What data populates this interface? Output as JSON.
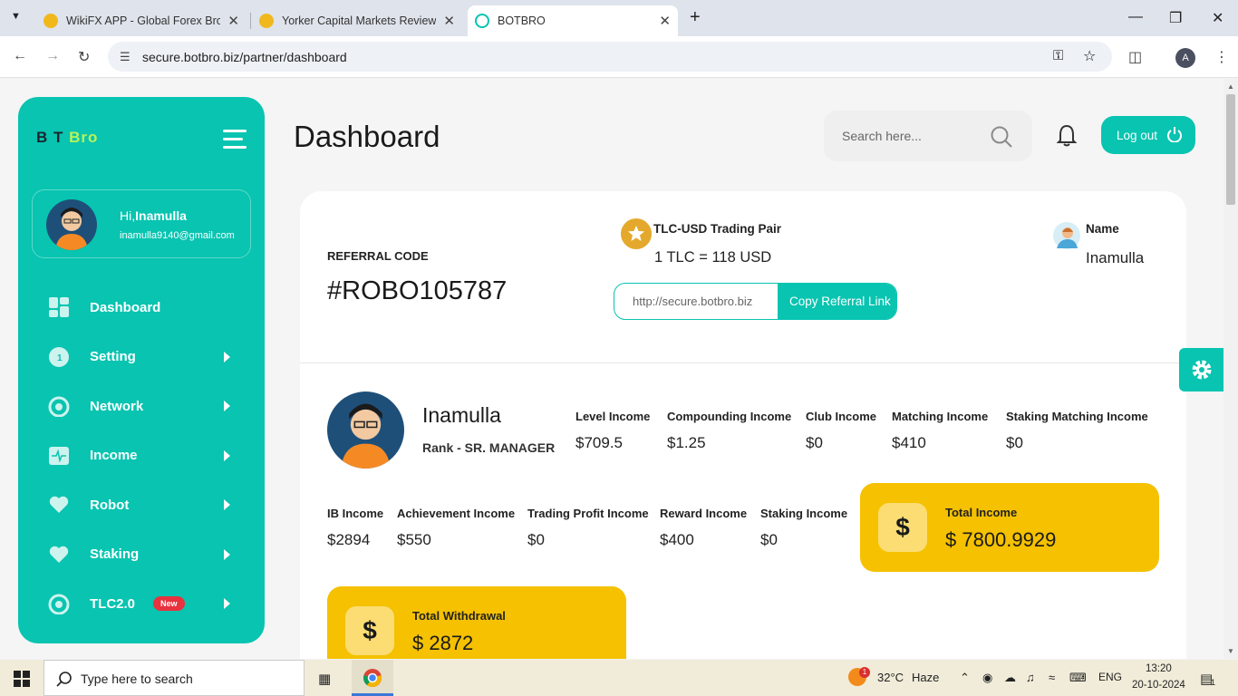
{
  "browser": {
    "tabs": [
      {
        "title": "WikiFX APP - Global Forex Brok",
        "active": false
      },
      {
        "title": "Yorker Capital Markets Review, I",
        "active": false
      },
      {
        "title": "BOTBRO",
        "active": true
      }
    ],
    "url": "secure.botbro.biz/partner/dashboard",
    "profile_initial": "A"
  },
  "sidebar": {
    "logo_bot": "B  T",
    "logo_bro": "Bro",
    "greeting": "Hi,",
    "user": "Inamulla",
    "email": "inamulla9140@gmail.com",
    "items": [
      {
        "label": "Dashboard",
        "icon": "dashboard-icon",
        "arrow": false
      },
      {
        "label": "Setting",
        "icon": "setting-icon",
        "arrow": true
      },
      {
        "label": "Network",
        "icon": "network-icon",
        "arrow": true
      },
      {
        "label": "Income",
        "icon": "income-icon",
        "arrow": true
      },
      {
        "label": "Robot",
        "icon": "heart-icon",
        "arrow": true
      },
      {
        "label": "Staking",
        "icon": "heart-icon",
        "arrow": true
      },
      {
        "label": "TLC2.0",
        "icon": "tlc-icon",
        "arrow": true,
        "badge": "New"
      }
    ]
  },
  "header": {
    "title": "Dashboard",
    "search_placeholder": "Search here...",
    "logout": "Log out"
  },
  "referral": {
    "label": "REFERRAL CODE",
    "code": "#ROBO105787",
    "pair_label": "TLC-USD Trading Pair",
    "pair_value": "1 TLC = 118 USD",
    "link": "http://secure.botbro.biz",
    "copy_button": "Copy Referral Link",
    "name_label": "Name",
    "name_value": "Inamulla"
  },
  "profile": {
    "name": "Inamulla",
    "rank": "Rank - SR. MANAGER"
  },
  "incomes_row1": [
    {
      "label": "Level Income",
      "value": "$709.5"
    },
    {
      "label": "Compounding Income",
      "value": "$1.25"
    },
    {
      "label": "Club Income",
      "value": "$0"
    },
    {
      "label": "Matching Income",
      "value": "$410"
    },
    {
      "label": "Staking Matching Income",
      "value": "$0"
    }
  ],
  "incomes_row2": [
    {
      "label": "IB Income",
      "value": "$2894"
    },
    {
      "label": "Achievement Income",
      "value": "$550"
    },
    {
      "label": "Trading Profit Income",
      "value": "$0"
    },
    {
      "label": "Reward Income",
      "value": "$400"
    },
    {
      "label": "Staking Income",
      "value": "$0"
    }
  ],
  "totals": {
    "income_label": "Total Income",
    "income_value": "$ 7800.9929",
    "withdrawal_label": "Total Withdrawal",
    "withdrawal_value": "$ 2872",
    "currency_symbol": "$"
  },
  "taskbar": {
    "search": "Type here to search",
    "temp": "32°C",
    "weather": "Haze",
    "lang": "ENG",
    "time": "13:20",
    "date": "20-10-2024",
    "weather_badge": "1",
    "notif_count": "1"
  },
  "colors": {
    "accent": "#08c4b0",
    "gold": "#f5c100"
  }
}
